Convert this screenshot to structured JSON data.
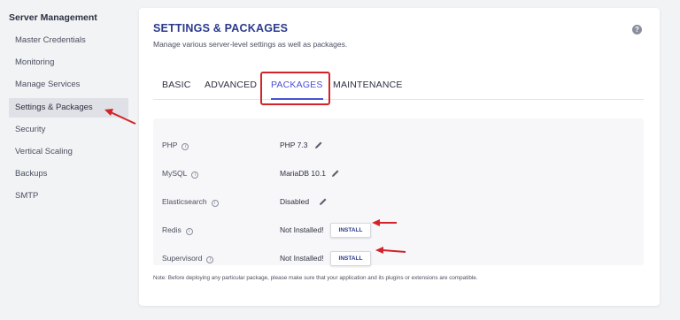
{
  "sidebar": {
    "heading": "Server Management",
    "items": [
      {
        "label": "Master Credentials"
      },
      {
        "label": "Monitoring"
      },
      {
        "label": "Manage Services"
      },
      {
        "label": "Settings & Packages"
      },
      {
        "label": "Security"
      },
      {
        "label": "Vertical Scaling"
      },
      {
        "label": "Backups"
      },
      {
        "label": "SMTP"
      }
    ]
  },
  "card": {
    "title": "SETTINGS & PACKAGES",
    "subtitle": "Manage various server-level settings as well as packages.",
    "help_icon": "?",
    "tabs": [
      {
        "label": "BASIC"
      },
      {
        "label": "ADVANCED"
      },
      {
        "label": "PACKAGES"
      },
      {
        "label": "MAINTENANCE"
      }
    ],
    "active_tab": "PACKAGES",
    "packages": [
      {
        "name": "PHP",
        "value": "PHP 7.3",
        "action": "edit"
      },
      {
        "name": "MySQL",
        "value": "MariaDB 10.1",
        "action": "edit"
      },
      {
        "name": "Elasticsearch",
        "value": "Disabled",
        "action": "edit"
      },
      {
        "name": "Redis",
        "value": "Not Installed!",
        "action": "INSTALL"
      },
      {
        "name": "Supervisord",
        "value": "Not Installed!",
        "action": "INSTALL"
      }
    ],
    "note": "Note: Before deploying any particular package, please make sure that your application and its plugins or extensions are compatible."
  },
  "icons": {
    "info": "info-icon",
    "edit": "pencil-icon",
    "help": "question-icon"
  },
  "colors": {
    "accent": "#4b4fd6",
    "title": "#2b3a8c",
    "annotation": "#d3232a"
  }
}
